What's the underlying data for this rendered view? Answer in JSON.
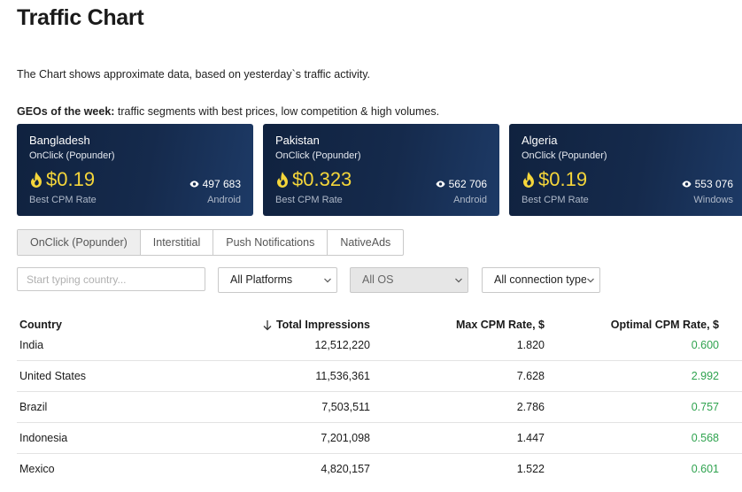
{
  "page": {
    "title": "Traffic Chart",
    "subtitle": "The Chart shows approximate data, based on yesterday`s traffic activity.",
    "geo_bold": "GEOs of the week:",
    "geo_text": " traffic segments with best prices, low competition & high volumes."
  },
  "cards": [
    {
      "country": "Bangladesh",
      "product": "OnClick (Popunder)",
      "price": "$0.19",
      "rate_label": "Best CPM Rate",
      "impressions": "497 683",
      "platform": "Android"
    },
    {
      "country": "Pakistan",
      "product": "OnClick (Popunder)",
      "price": "$0.323",
      "rate_label": "Best CPM Rate",
      "impressions": "562 706",
      "platform": "Android"
    },
    {
      "country": "Algeria",
      "product": "OnClick (Popunder)",
      "price": "$0.19",
      "rate_label": "Best CPM Rate",
      "impressions": "553 076",
      "platform": "Windows"
    }
  ],
  "tabs": [
    {
      "label": "OnClick (Popunder)",
      "active": true
    },
    {
      "label": "Interstitial",
      "active": false
    },
    {
      "label": "Push Notifications",
      "active": false
    },
    {
      "label": "NativeAds",
      "active": false
    }
  ],
  "filters": {
    "search_placeholder": "Start typing country...",
    "platforms": "All Platforms",
    "os": "All OS",
    "connection": "All connection types"
  },
  "table": {
    "headers": {
      "country": "Country",
      "impressions": "Total Impressions",
      "max_cpm": "Max CPM Rate, $",
      "optimal_cpm": "Optimal CPM Rate, $"
    },
    "rows": [
      {
        "country": "India",
        "impressions": "12,512,220",
        "max_cpm": "1.820",
        "optimal_cpm": "0.600"
      },
      {
        "country": "United States",
        "impressions": "11,536,361",
        "max_cpm": "7.628",
        "optimal_cpm": "2.992"
      },
      {
        "country": "Brazil",
        "impressions": "7,503,511",
        "max_cpm": "2.786",
        "optimal_cpm": "0.757"
      },
      {
        "country": "Indonesia",
        "impressions": "7,201,098",
        "max_cpm": "1.447",
        "optimal_cpm": "0.568"
      },
      {
        "country": "Mexico",
        "impressions": "4,820,157",
        "max_cpm": "1.522",
        "optimal_cpm": "0.601"
      }
    ]
  },
  "colors": {
    "card_bg": "#152a4c",
    "price": "#f5d63a",
    "optimal_value": "#2fa34f"
  },
  "icons": {
    "fire": "fire-icon",
    "eye": "eye-icon",
    "chevron": "chevron-down-icon",
    "sort": "arrow-down-icon"
  }
}
